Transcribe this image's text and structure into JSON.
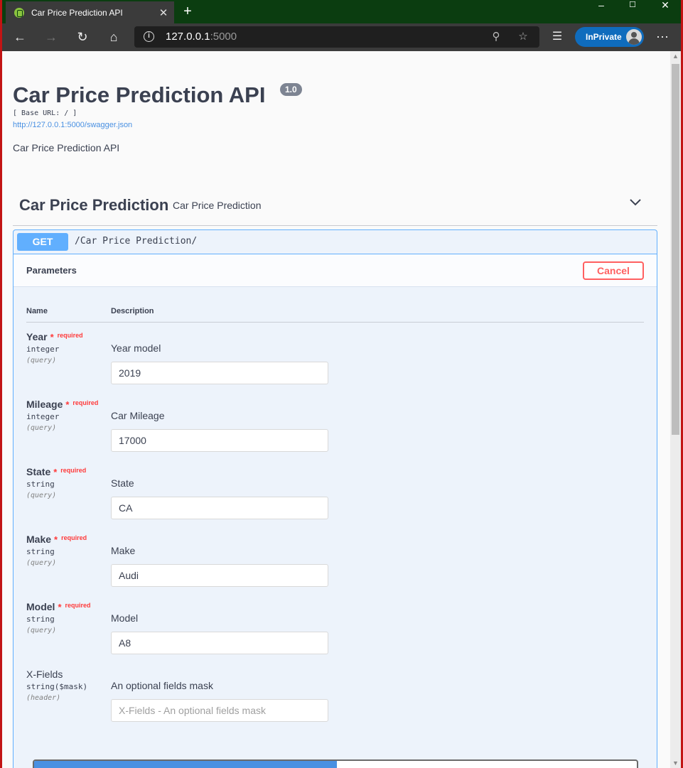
{
  "browser": {
    "tab_title": "Car Price Prediction API",
    "url_host": "127.0.0.1",
    "url_port": ":5000",
    "inprivate_label": "InPrivate"
  },
  "api": {
    "title": "Car Price Prediction API",
    "version": "1.0",
    "base_url": "[ Base URL: / ]",
    "swagger_link": "http://127.0.0.1:5000/swagger.json",
    "description": "Car Price Prediction API"
  },
  "tag": {
    "name": "Car Price Prediction",
    "description": "Car Price Prediction"
  },
  "operation": {
    "method": "GET",
    "path": "/Car Price Prediction/",
    "parameters_title": "Parameters",
    "cancel_label": "Cancel",
    "col_name": "Name",
    "col_description": "Description",
    "params": [
      {
        "name": "Year",
        "required": true,
        "type": "integer",
        "in": "(query)",
        "description": "Year model",
        "value": "2019",
        "placeholder": ""
      },
      {
        "name": "Mileage",
        "required": true,
        "type": "integer",
        "in": "(query)",
        "description": "Car Mileage",
        "value": "17000",
        "placeholder": ""
      },
      {
        "name": "State",
        "required": true,
        "type": "string",
        "in": "(query)",
        "description": "State",
        "value": "CA",
        "placeholder": ""
      },
      {
        "name": "Make",
        "required": true,
        "type": "string",
        "in": "(query)",
        "description": "Make",
        "value": "Audi",
        "placeholder": ""
      },
      {
        "name": "Model",
        "required": true,
        "type": "string",
        "in": "(query)",
        "description": "Model",
        "value": "A8",
        "placeholder": ""
      },
      {
        "name": "X-Fields",
        "required": false,
        "type": "string($mask)",
        "in": "(header)",
        "description": "An optional fields mask",
        "value": "",
        "placeholder": "X-Fields - An optional fields mask"
      }
    ],
    "required_marker": "*",
    "required_label": "required"
  },
  "colors": {
    "get_method": "#61affe",
    "cancel": "#ff6060",
    "required": "#ff3a3a",
    "execute": "#4990e2"
  }
}
